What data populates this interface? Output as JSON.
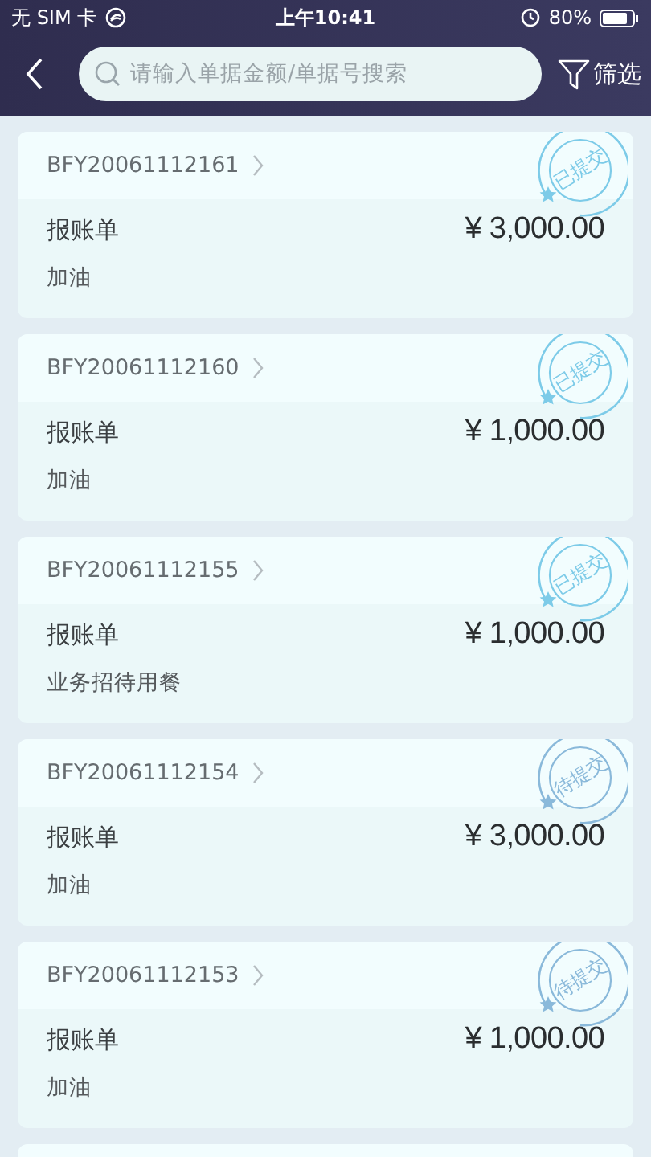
{
  "status_bar": {
    "carrier": "无 SIM 卡",
    "time": "上午10:41",
    "battery": "80%"
  },
  "nav": {
    "search": {
      "placeholder": "请输入单据金额/单据号搜索"
    },
    "filter": "筛选"
  },
  "bills": [
    {
      "number": "BFY20061112161",
      "type": "报账单",
      "amount": "¥ 3,000.00",
      "desc": "加油",
      "stamp": {
        "kind": "submitted",
        "text": "已提交"
      }
    },
    {
      "number": "BFY20061112160",
      "type": "报账单",
      "amount": "¥ 1,000.00",
      "desc": "加油",
      "stamp": {
        "kind": "submitted",
        "text": "已提交"
      }
    },
    {
      "number": "BFY20061112155",
      "type": "报账单",
      "amount": "¥ 1,000.00",
      "desc": "业务招待用餐",
      "stamp": {
        "kind": "submitted",
        "text": "已提交"
      }
    },
    {
      "number": "BFY20061112154",
      "type": "报账单",
      "amount": "¥ 3,000.00",
      "desc": "加油",
      "stamp": {
        "kind": "pending",
        "text": "待提交"
      }
    },
    {
      "number": "BFY20061112153",
      "type": "报账单",
      "amount": "¥ 1,000.00",
      "desc": "加油",
      "stamp": {
        "kind": "pending",
        "text": "待提交"
      }
    }
  ]
}
